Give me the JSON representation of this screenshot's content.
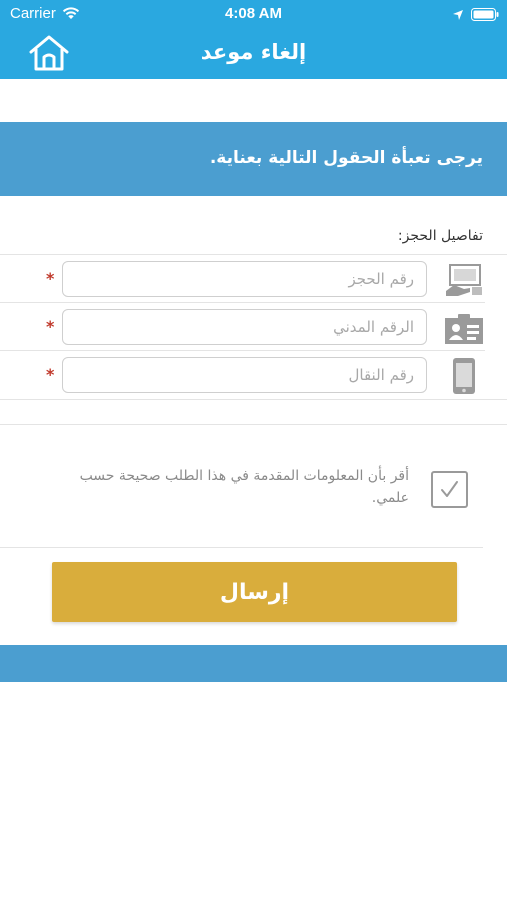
{
  "status_bar": {
    "carrier": "Carrier",
    "time": "4:08 AM"
  },
  "header": {
    "title": "إلغاء موعد",
    "background_color": "#2aa8e0"
  },
  "banner": {
    "text": "يرجى تعبأة الحقول التالية بعناية.",
    "background_color": "#4b9ed0"
  },
  "form": {
    "section_label": "تفاصيل الحجز:",
    "fields": [
      {
        "placeholder": "رقم الحجز",
        "value": "",
        "required_mark": "*",
        "icon": "booking-laptop-icon"
      },
      {
        "placeholder": "الرقم المدني",
        "value": "",
        "required_mark": "*",
        "icon": "id-card-icon"
      },
      {
        "placeholder": "رقم النقال",
        "value": "",
        "required_mark": "*",
        "icon": "mobile-phone-icon"
      }
    ],
    "consent": {
      "text": "أقر بأن المعلومات المقدمة في هذا الطلب صحيحة حسب علمي.",
      "checked": true
    },
    "submit_label": "إرسال",
    "submit_color": "#d9ad3c"
  }
}
